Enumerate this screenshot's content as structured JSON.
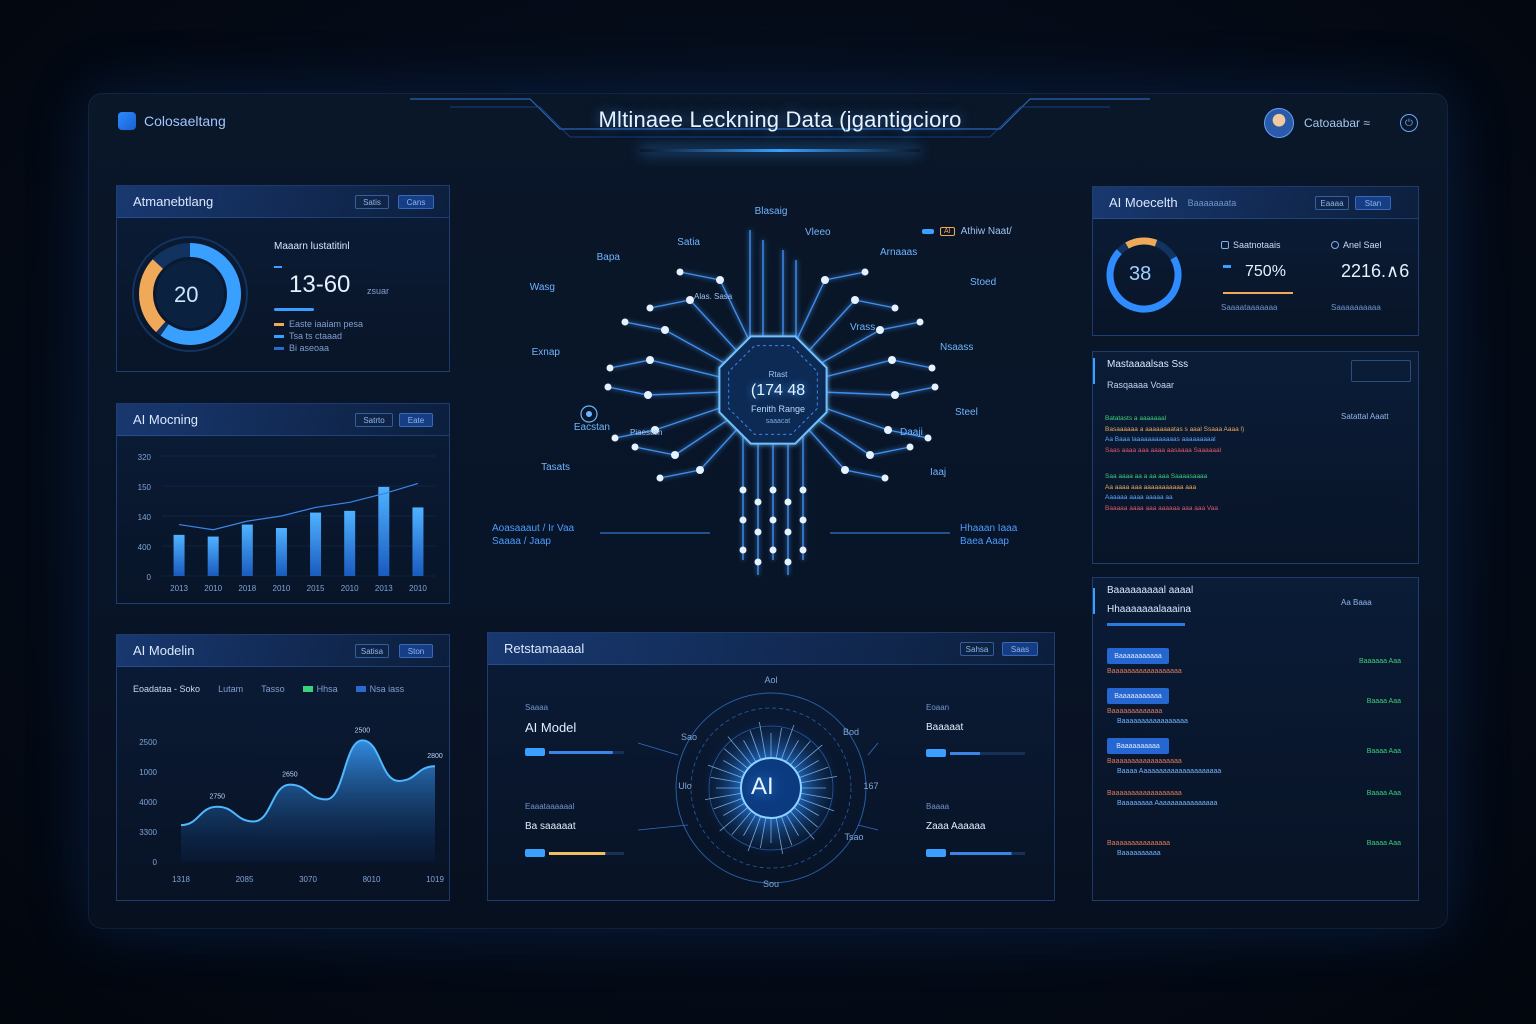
{
  "header": {
    "brand": "Colosaeltang",
    "title": "Mltinaee Leckning Data (jgantigcioro",
    "user_name": "Catoaabar ≈"
  },
  "panel_left_1": {
    "title": "Atmanebtlang",
    "btn_1": "Satis",
    "btn_2": "Cans",
    "donut_value": "20",
    "stat_label": "Maaarn lustatitinl",
    "stat_value": "13-60",
    "stat_sub": "zsuar",
    "legend_1": "Easte iaaiam pesa",
    "legend_2": "Tsa ts ctaaad",
    "legend_3": "Bi aseoaa",
    "colors": {
      "orange": "#f0a958",
      "blue": "#3aa0ff",
      "dark": "#12335f"
    }
  },
  "panel_left_2": {
    "title": "AI Mocning",
    "btn_1": "Satrto",
    "btn_2": "Eate",
    "y_ticks": [
      "320",
      "150",
      "140",
      "400",
      "0"
    ],
    "chart_data": {
      "type": "bar",
      "categories": [
        "2013",
        "2010",
        "2018",
        "2010",
        "2015",
        "2010",
        "2013",
        "2010"
      ],
      "values": [
        120,
        115,
        150,
        140,
        185,
        190,
        260,
        200
      ],
      "line": [
        150,
        135,
        160,
        175,
        200,
        215,
        240,
        270
      ],
      "ylim": [
        0,
        350
      ]
    }
  },
  "panel_left_3": {
    "title": "AI Modelin",
    "btn_1": "Satisa",
    "btn_2": "Ston",
    "legend_1": "Eoadataa - Soko",
    "legend_2": "Lutam",
    "legend_3": "Tasso",
    "legend_4": "Hhsa",
    "legend_5": "Nsa iass",
    "peak_labels": [
      "2750",
      "2650",
      "2500",
      "2800"
    ],
    "y_ticks": [
      "2500",
      "1000",
      "4000",
      "3300",
      "0"
    ],
    "chart_data": {
      "type": "area",
      "x": [
        "1318",
        "2085",
        "3070",
        "8010",
        "1019"
      ],
      "values": [
        1000,
        1500,
        1100,
        2100,
        1700,
        3300,
        2200,
        2600
      ],
      "ylim": [
        0,
        3800
      ]
    }
  },
  "center_network": {
    "chip_line_1": "Rtast",
    "chip_value": "(174 48",
    "chip_line_2": "Fenith Range",
    "chip_line_3": "saaacat",
    "top_label": "Blasaig",
    "nodes": [
      {
        "name": "Satia",
        "side": "left"
      },
      {
        "name": "Bapa",
        "side": "left"
      },
      {
        "name": "Wasg",
        "side": "left"
      },
      {
        "name": "Exnap",
        "side": "left"
      },
      {
        "name": "Tasats",
        "side": "left"
      },
      {
        "name": "Eacstan",
        "side": "left"
      },
      {
        "name": "Vleeo",
        "side": "right"
      },
      {
        "name": "Arnaaas",
        "side": "right"
      },
      {
        "name": "Stoed",
        "side": "right"
      },
      {
        "name": "Nsaass",
        "side": "right"
      },
      {
        "name": "Steel",
        "side": "right"
      },
      {
        "name": "Iaaj",
        "side": "right"
      },
      {
        "name": "Vrass",
        "side": "right"
      },
      {
        "name": "Daaji",
        "side": "right"
      }
    ],
    "badge": "AI",
    "badge_text": "Athiw Naat/",
    "left_caption_1": "Aoasaaaut / Ir Vaa",
    "left_caption_2": "Saaaa / Jaap",
    "right_caption_1": "Hhaaan Iaaa",
    "right_caption_2": "Baea Aaap",
    "small_top_left": "Alas. Sasa",
    "small_left_mid": "Piaestisn"
  },
  "panel_center": {
    "title": "Retstamaaaal",
    "btn_1": "Sahsa",
    "btn_2": "Saas",
    "core_label": "AI",
    "left_1_small": "Saaaa",
    "left_1_label": "AI Model",
    "left_2_small": "Eaaataaaaaal",
    "left_2_label": "Ba saaaaat",
    "right_1_small": "Eoaan",
    "right_1_label": "Baaaaat",
    "right_2_small": "Baaaa",
    "right_2_label": "Zaaa Aaaaaa",
    "progress": {
      "left_1": 0.85,
      "left_2": 0.75,
      "right_1": 0.4,
      "right_2": 0.82
    },
    "ring_labels": [
      "Aol",
      "Bod",
      "Ulo",
      "167",
      "Sao",
      "Tsao",
      "Sou"
    ]
  },
  "panel_right_1": {
    "title": "AI Moecelth",
    "subtitle": "Baaaaaaata",
    "btn_1": "Eaaaa",
    "btn_2": "Stan",
    "ring_value": "38",
    "metric_1_label": "Saatnotaais",
    "metric_1_value": "750%",
    "metric_1_sub": "Saaaataaaaaaa",
    "metric_2_label": "Anel Sael",
    "metric_2_value": "2216.∧6",
    "metric_2_sub": "Saaaaaaaaaa"
  },
  "panel_right_2": {
    "title": "Mastaaaalsas Sss",
    "subtitle": "Rasqaaaa Voaar",
    "badge": "Satattal Aaatt",
    "lines": [
      "Batatasts a aaaaaaal",
      "Basaaaaaa a aaaaaaaatas s aaal  Ssaaa  Aaaa l)",
      "Aa Baaa laaaaaaaaaaaas aaaaaaaaal",
      "Saas aaaa aaa aaaa aasaaaa  Saaaaaal",
      "Saa aaaa aa a aa aaa Saaaasaaaa",
      "Aa aaaa aaa aaaaaaaaaaa aaa",
      "Aaaaaa aaaa aaaaa aa",
      "Baaaaa aaaa aaa aaaaaa aaa  aaa  Vaa"
    ]
  },
  "panel_right_3": {
    "title": "Baaaaaaaaal aaaal",
    "subtitle": "Hhaaaaaaalaaaina",
    "top_right": "Aa  Baaa",
    "buttons": [
      "Baaaaaaaaaaa",
      "Baaaaaaaaaaa",
      "Baaaaaaaaaa"
    ],
    "rows": [
      {
        "a": "Baaaaaaaaaaaaaaaaaa",
        "b": "",
        "c": "Baaaaaa  Aaa"
      },
      {
        "a": "Baaaaaaaaaaaaa",
        "b": "Baaaaaaaaaaaaaaaaa",
        "c": "Baaaa  Aaa"
      },
      {
        "a": "Baaaaaaaaaaaaaaaaaa",
        "b": "Baaaa Aaaaaaaaaaaaaaaaaaaaa",
        "c": "Baaaa Aaa"
      },
      {
        "a": "Baaaaaaaaaaaaaaaaaa",
        "b": "Baaaaaaaa Aaaaaaaaaaaaaaaa",
        "c": "Baaaa  Aaa"
      },
      {
        "a": "Baaaaaaaaaaaaaaa",
        "b": "Baaaaaaaaaa",
        "c": "Baaaa  Aaa"
      }
    ]
  }
}
